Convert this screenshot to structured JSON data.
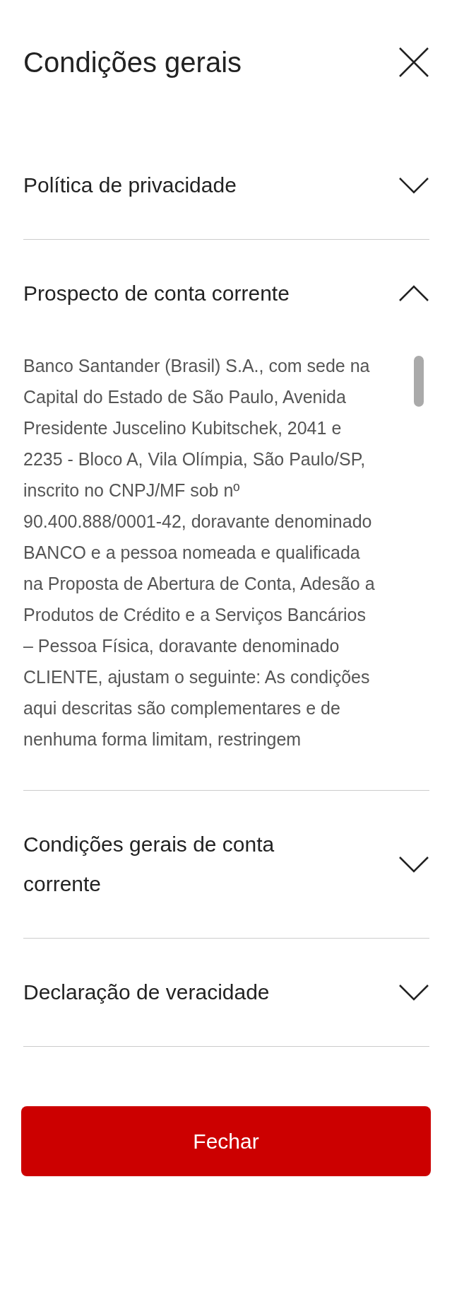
{
  "title": "Condições gerais",
  "sections": [
    {
      "title": "Política de privacidade",
      "expanded": false
    },
    {
      "title": "Prospecto de conta corrente",
      "expanded": true,
      "body": "Banco Santander (Brasil) S.A., com sede na Capital do Estado de São Paulo, Avenida Presidente Juscelino Kubitschek, 2041 e 2235 - Bloco A, Vila Olímpia, São Paulo/SP, inscrito no CNPJ/MF sob nº 90.400.888/0001-42, doravante denominado BANCO e a pessoa nomeada e qualificada na Proposta de Abertura de Conta, Adesão a Produtos de Crédito e a Serviços Bancários – Pessoa Física, doravante denominado CLIENTE, ajustam o seguinte: As condições aqui descritas são complementares e de nenhuma forma limitam, restringem"
    },
    {
      "title": "Condições gerais de conta corrente",
      "expanded": false
    },
    {
      "title": "Declaração de veracidade",
      "expanded": false
    }
  ],
  "button": "Fechar"
}
